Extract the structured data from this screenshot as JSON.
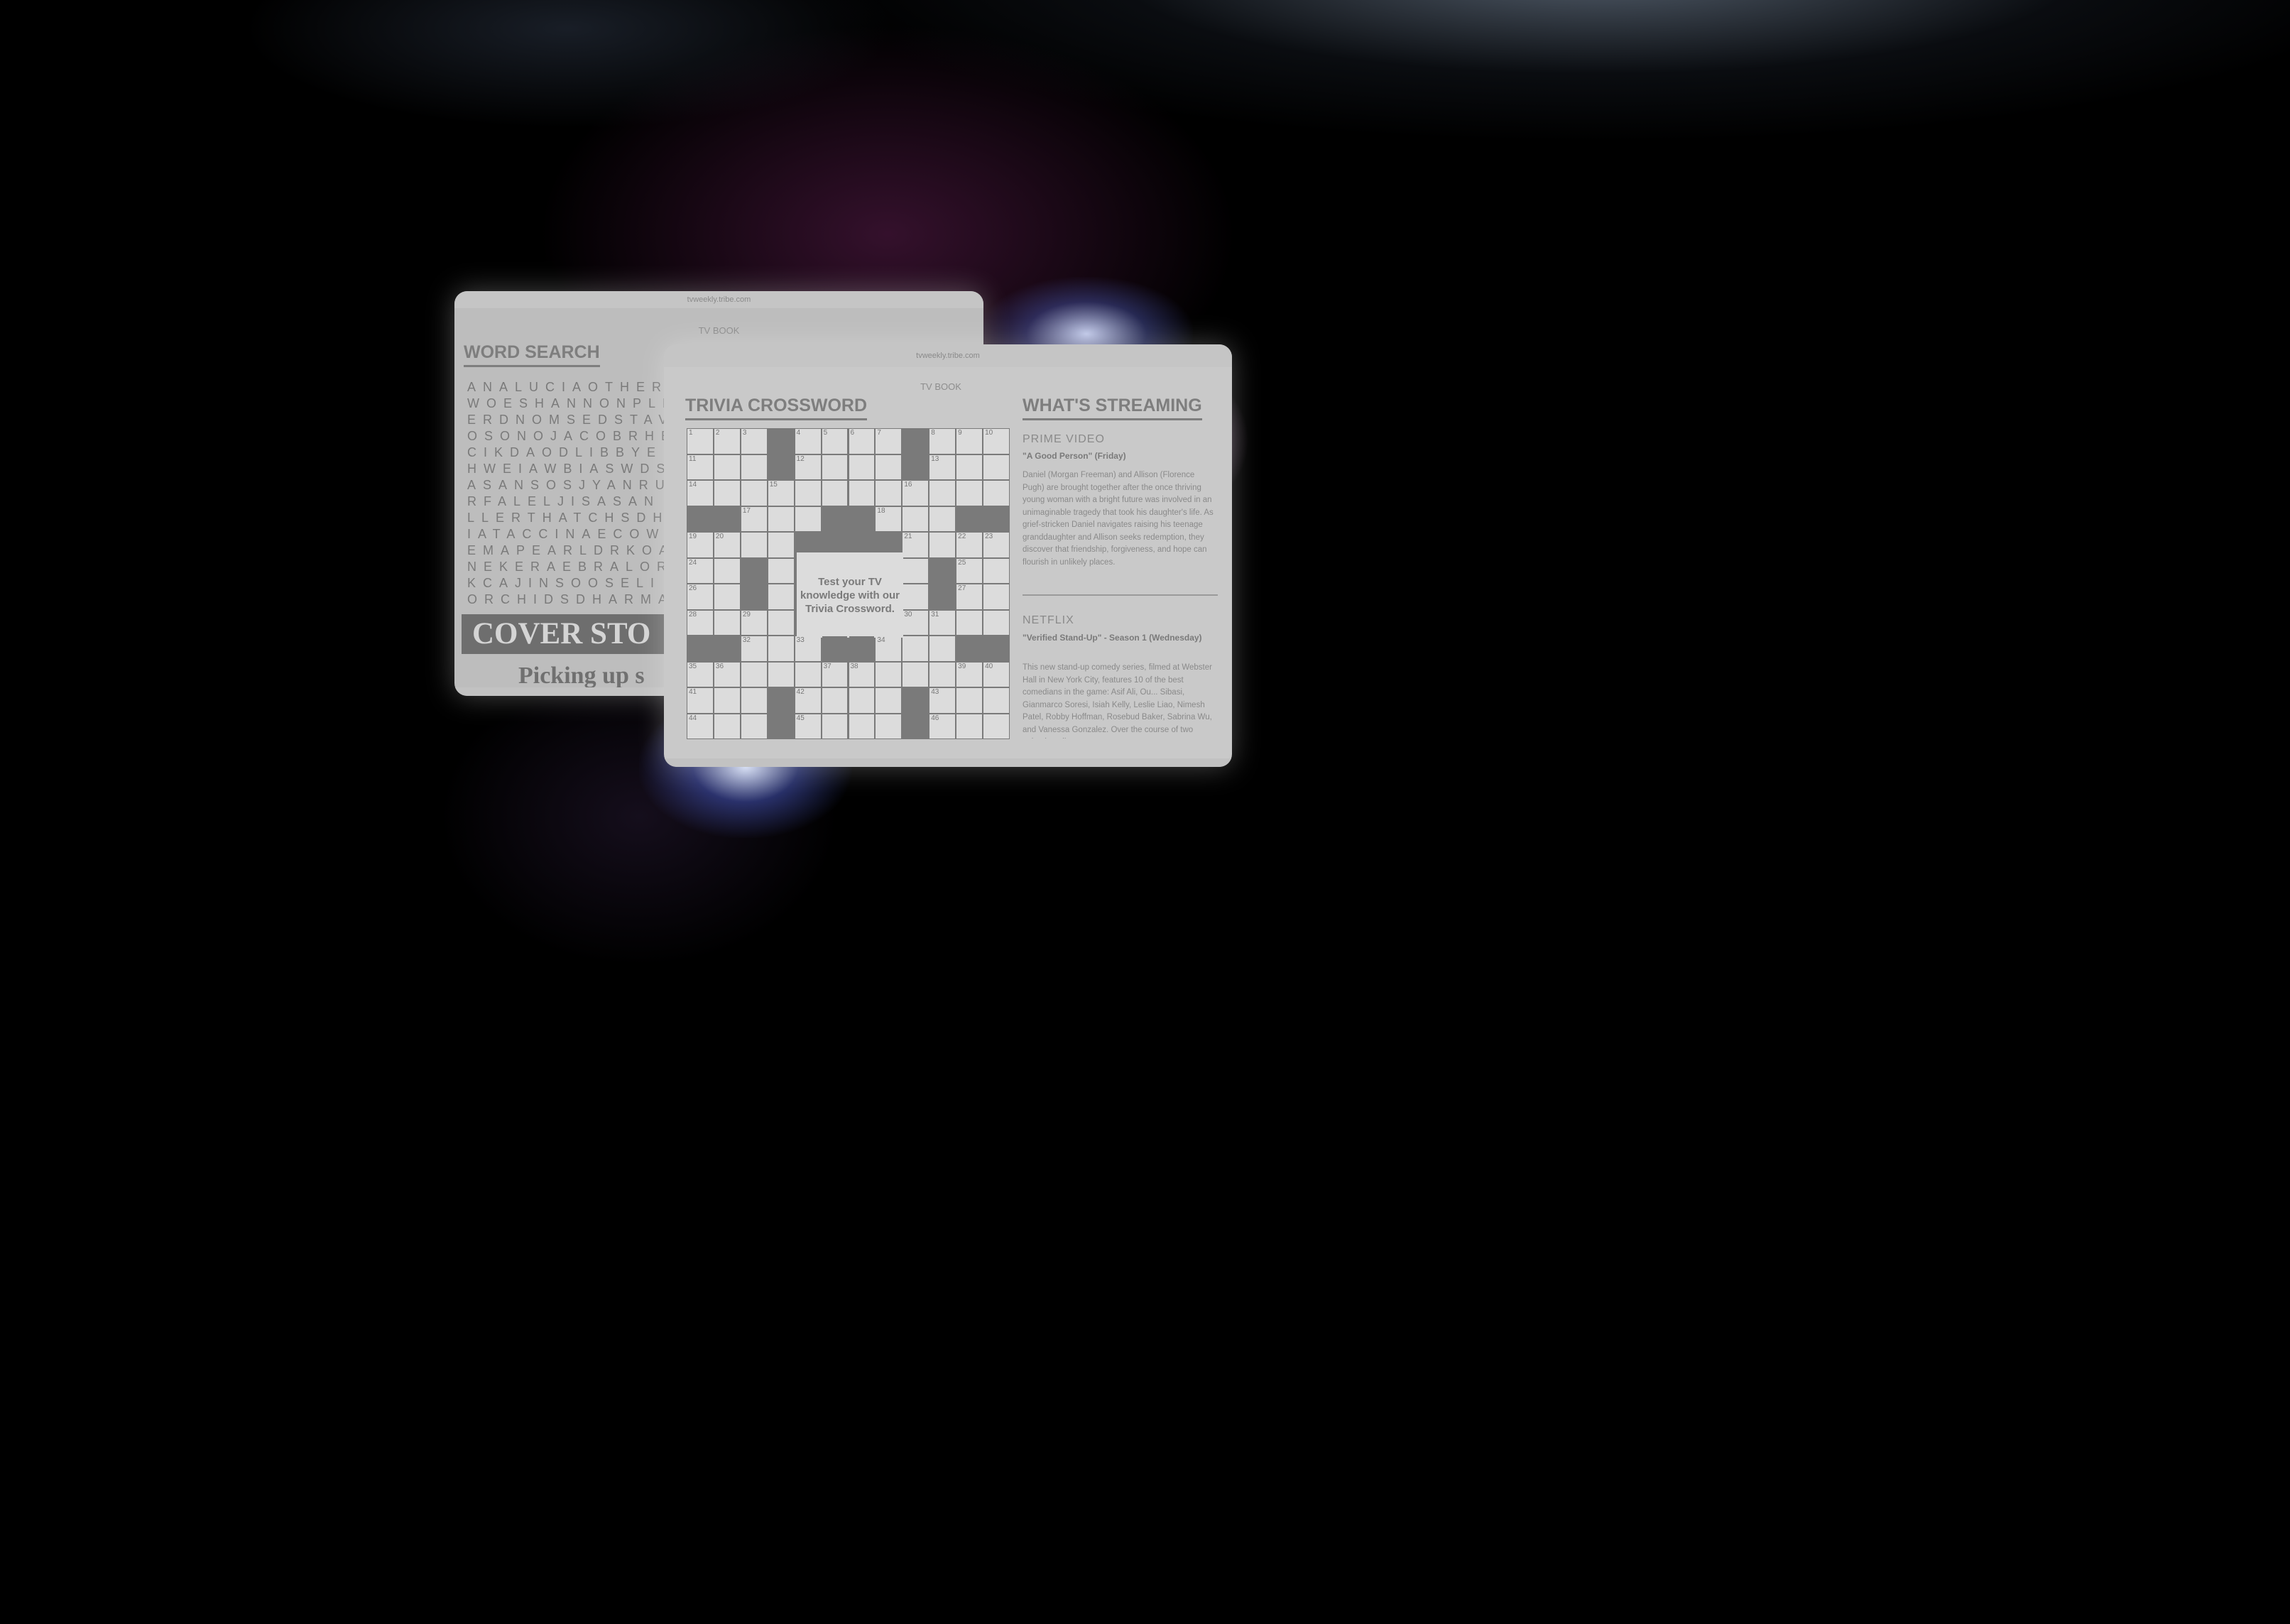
{
  "left_window": {
    "url": "tvweekly.tribe.com",
    "publication": "TV BOOK",
    "section_title": "WORD SEARCH",
    "word_search_rows": [
      "ANALUCIAOTHER",
      "WOESHANNONPLM",
      "ERDNOMSEDSTAV",
      "OSONOJACOBRHE",
      "CIKDAODLIBBYE",
      "HWEIAWBIASWDS",
      "ASANSOSJYANRU",
      "RFALELJISASAN",
      "LLERTHATCHSDH",
      "IATACCINAECOW",
      "EMAPEARLDRKOA",
      "NEKERAEBRALOR",
      "KCAJINSOOSELI",
      "ORCHIDSDHARMA"
    ],
    "cover_banner": "COVER STO",
    "cover_subtitle": "Picking up s"
  },
  "right_window": {
    "url": "tvweekly.tribe.com",
    "publication": "TV BOOK",
    "crossword_title": "TRIVIA CROSSWORD",
    "crossword_prompt": "Test your TV knowledge with our Trivia Crossword.",
    "streaming_title": "WHAT'S STREAMING",
    "streaming": [
      {
        "platform": "PRIME VIDEO",
        "show": "\"A Good Person\" (Friday)",
        "description": "Daniel (Morgan Freeman) and Allison (Florence Pugh) are brought together after the once thriving young woman with a bright future was involved in an unimaginable tragedy that took his daughter's life. As grief-stricken Daniel navigates raising his teenage granddaughter and Allison seeks redemption, they discover that friendship, forgiveness, and hope can flourish in unlikely places."
      },
      {
        "platform": "NETFLIX",
        "show": "\"Verified Stand-Up\" - Season 1 (Wednesday)",
        "description": "This new stand-up comedy series, filmed at Webster Hall in New York City, features 10 of the best comedians in the game: Asif Ali, Ou... Sibasi, Gianmarco Soresi, Isiah Kelly, Leslie Liao, Nimesh Patel, Robby Hoffman, Rosebud Baker, Sabrina Wu, and Vanessa Gonzalez. Over the course of two episodes, discover"
      }
    ]
  }
}
